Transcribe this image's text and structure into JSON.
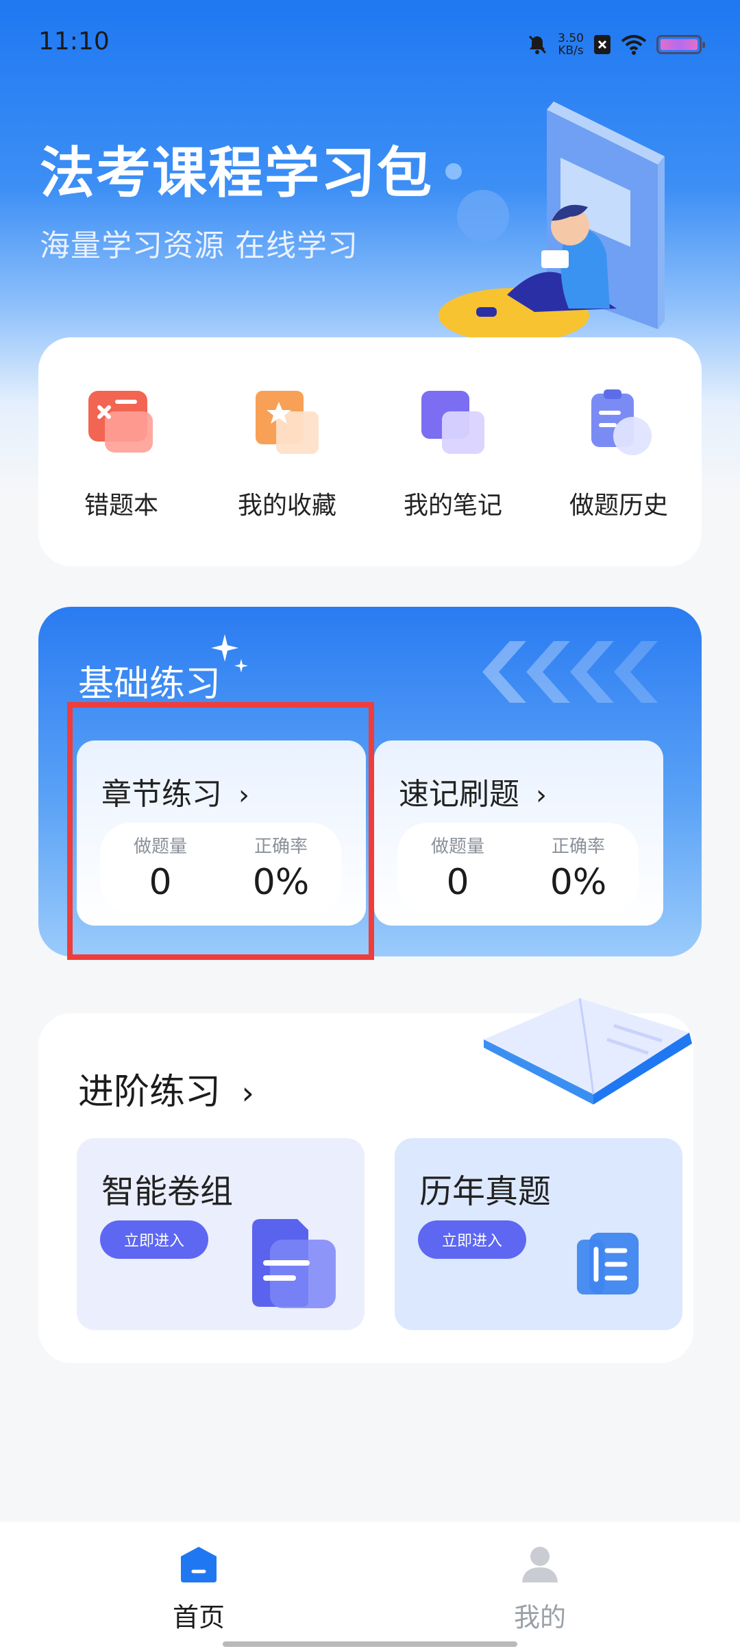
{
  "status_bar": {
    "time": "11:10",
    "net_speed_value": "3.50",
    "net_speed_unit": "KB/s"
  },
  "hero": {
    "title": "法考课程学习包",
    "subtitle": "海量学习资源 在线学习"
  },
  "quick_actions": [
    {
      "label": "错题本",
      "icon": "wrong-questions-icon"
    },
    {
      "label": "我的收藏",
      "icon": "favorites-icon"
    },
    {
      "label": "我的笔记",
      "icon": "notes-icon"
    },
    {
      "label": "做题历史",
      "icon": "history-icon"
    }
  ],
  "basic_practice": {
    "title": "基础练习",
    "items": [
      {
        "title": "章节练习",
        "stat1_label": "做题量",
        "stat1_value": "0",
        "stat2_label": "正确率",
        "stat2_value": "0%"
      },
      {
        "title": "速记刷题",
        "stat1_label": "做题量",
        "stat1_value": "0",
        "stat2_label": "正确率",
        "stat2_value": "0%"
      }
    ]
  },
  "advanced_practice": {
    "title": "进阶练习",
    "items": [
      {
        "title": "智能卷组",
        "button": "立即进入"
      },
      {
        "title": "历年真题",
        "button": "立即进入"
      }
    ]
  },
  "tab_bar": {
    "tabs": [
      {
        "label": "首页",
        "active": true
      },
      {
        "label": "我的",
        "active": false
      }
    ]
  },
  "colors": {
    "accent": "#1f78f2",
    "button": "#5d67f2",
    "highlight_border": "#ee3d3a"
  }
}
